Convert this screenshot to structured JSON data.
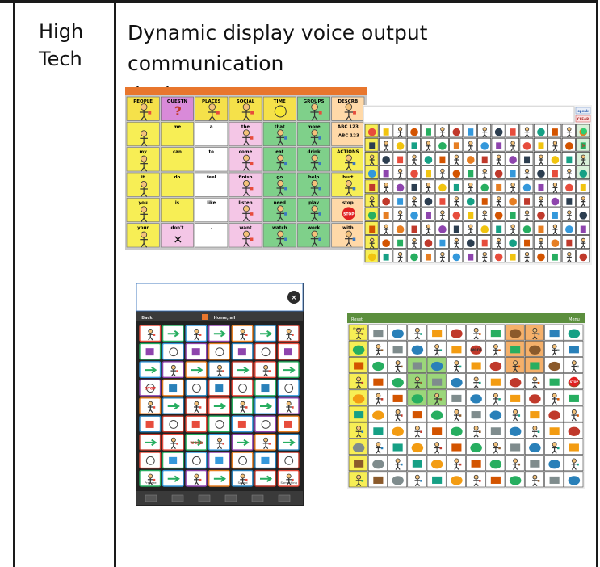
{
  "table": {
    "category_line1": "High",
    "category_line2": "Tech",
    "description_line1": "Dynamic display voice output communication",
    "description_line2": "device"
  },
  "board_a": {
    "header": [
      "PEOPLE",
      "QUESTN",
      "PLACES",
      "SOCIAL",
      "TIME",
      "GROUPS",
      "DESCRB"
    ],
    "rows": [
      [
        "",
        "me",
        "a",
        "the",
        "that",
        "more",
        "ABC 123"
      ],
      [
        "my",
        "can",
        "to",
        "come",
        "eat",
        "drink",
        "ACTIONS"
      ],
      [
        "it",
        "do",
        "feel",
        "finish",
        "go",
        "help",
        "hurt"
      ],
      [
        "you",
        "is",
        "like",
        "listen",
        "need",
        "play",
        "stop"
      ],
      [
        "your",
        "don't",
        ".",
        "want",
        "watch",
        "work",
        "with"
      ]
    ]
  },
  "board_b": {
    "buttons": [
      "speak",
      "CLEAR"
    ]
  },
  "board_c": {
    "top_left": "Back",
    "title": "Home, all",
    "bottom_labels": [
      "Prepare",
      "WORD",
      "Sound",
      "Something"
    ]
  },
  "board_d": {
    "top_left": "Reset",
    "top_right": "Menu",
    "labels": [
      "finished",
      "word",
      "STOP"
    ]
  }
}
